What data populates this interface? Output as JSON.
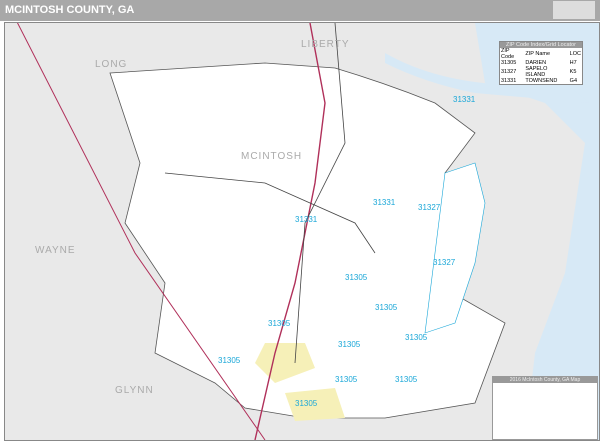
{
  "title": "MCINTOSH COUNTY, GA",
  "logo_text": "Market Maps",
  "county_labels": {
    "liberty": "LIBERTY",
    "long": "LONG",
    "mcintosh": "MCINTOSH",
    "wayne": "WAYNE",
    "glynn": "GLYNN"
  },
  "zip_labels": [
    "3",
    "31331",
    "31331",
    "31327",
    "31331",
    "31327",
    "31305",
    "31305",
    "31305",
    "31305",
    "31305",
    "31305",
    "31305",
    "31305",
    "31305"
  ],
  "zip_index": {
    "header": "ZIP Code Index/Grid Locator",
    "columns": [
      "ZIP Code",
      "ZIP Name",
      "LOC"
    ],
    "rows": [
      [
        "31305",
        "DARIEN",
        "H7"
      ],
      [
        "31327",
        "SAPELO ISLAND",
        "K5"
      ],
      [
        "31331",
        "TOWNSEND",
        "G4"
      ]
    ]
  },
  "legend": {
    "title": "2016 McIntosh County, GA Map"
  },
  "colors": {
    "land": "#e9e9e9",
    "county": "#ffffff",
    "water": "#d7e9f6",
    "zip": "#1aa7d8",
    "interstate": "#b0305a",
    "highway": "#333333",
    "urban": "#f6f0b8"
  }
}
